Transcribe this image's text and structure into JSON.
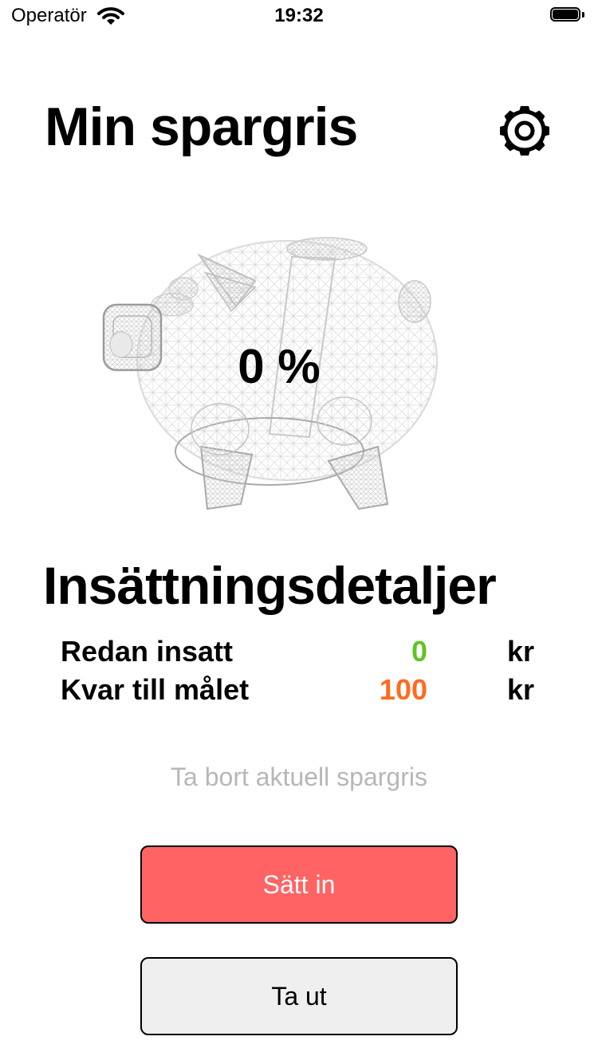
{
  "status_bar": {
    "carrier": "Operatör",
    "time": "19:32"
  },
  "header": {
    "title": "Min spargris",
    "settings_icon": "gear-icon"
  },
  "pig": {
    "percent_label": "0 %",
    "progress": 0
  },
  "details": {
    "title": "Insättningsdetaljer",
    "rows": [
      {
        "label": "Redan insatt",
        "value": "0",
        "unit": "kr",
        "color": "#5ec424"
      },
      {
        "label": "Kvar till målet",
        "value": "100",
        "unit": "kr",
        "color": "#ff6b1f"
      }
    ]
  },
  "actions": {
    "remove_label": "Ta bort aktuell spargris",
    "deposit_label": "Sätt in",
    "withdraw_label": "Ta ut",
    "deposit_color": "#ff6363"
  }
}
